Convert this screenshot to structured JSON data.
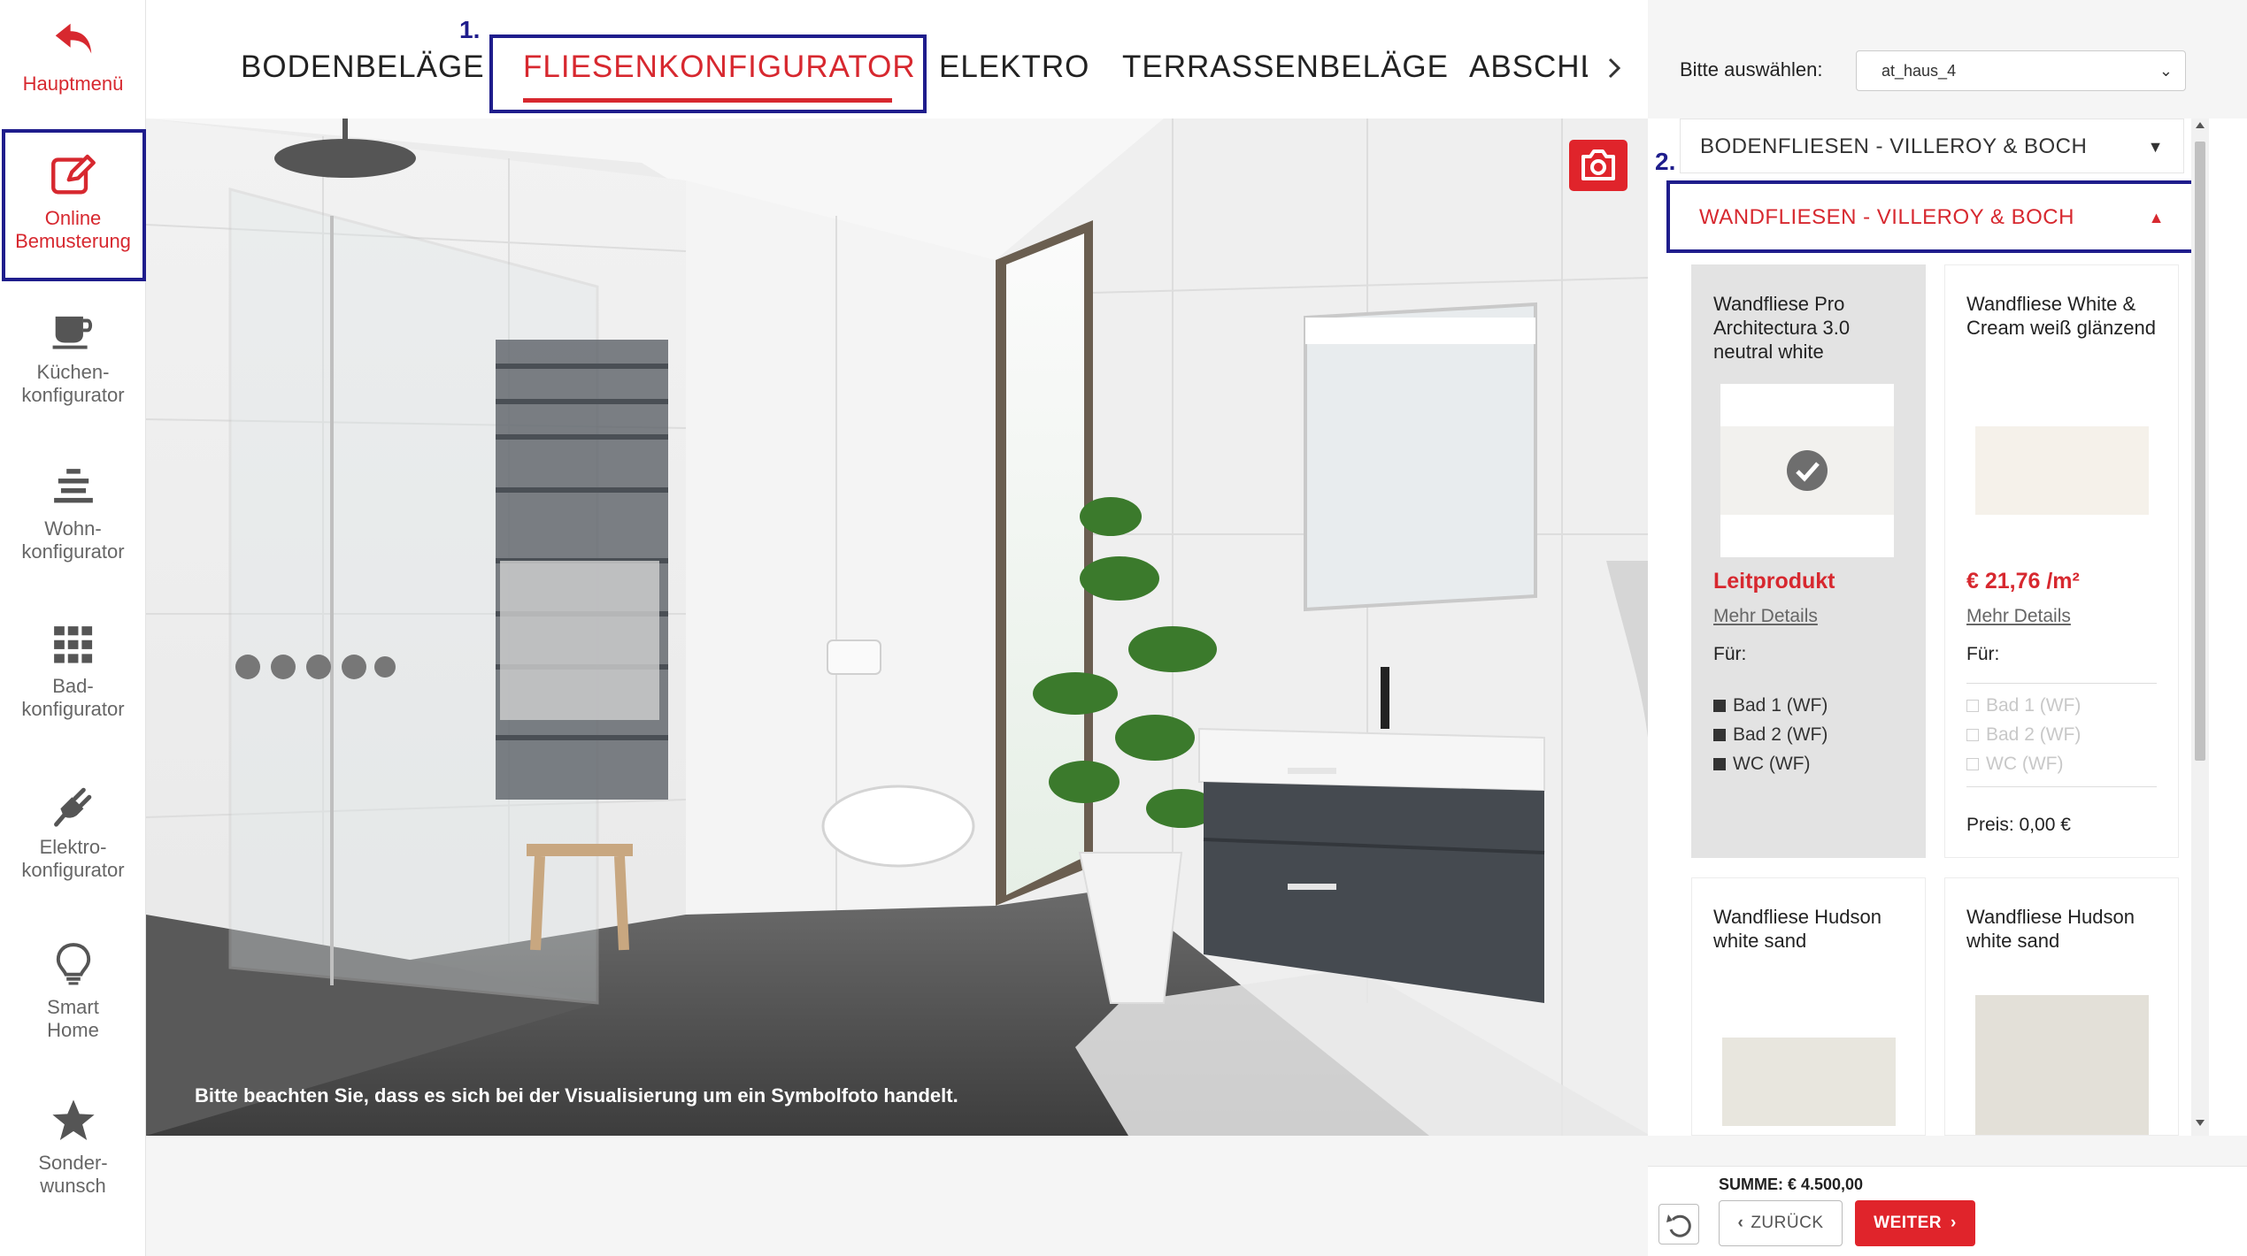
{
  "sidebar": {
    "items": [
      {
        "label": "Hauptmenü",
        "icon": "back-arrow-icon"
      },
      {
        "label_line1": "Online",
        "label_line2": "Bemusterung",
        "icon": "edit-icon"
      },
      {
        "label_line1": "Küchen-",
        "label_line2": "konfigurator",
        "icon": "cup-icon"
      },
      {
        "label_line1": "Wohn-",
        "label_line2": "konfigurator",
        "icon": "layers-icon"
      },
      {
        "label_line1": "Bad-",
        "label_line2": "konfigurator",
        "icon": "grid-icon"
      },
      {
        "label_line1": "Elektro-",
        "label_line2": "konfigurator",
        "icon": "plug-icon"
      },
      {
        "label_line1": "Smart",
        "label_line2": "Home",
        "icon": "lightbulb-icon"
      },
      {
        "label_line1": "Sonder-",
        "label_line2": "wunsch",
        "icon": "star-icon"
      }
    ]
  },
  "annotations": {
    "step1": "1.",
    "step2": "2."
  },
  "tabs": {
    "items": [
      "BODENBELÄGE",
      "FLIESENKONFIGURATOR",
      "ELEKTRO",
      "TERRASSENBELÄGE",
      "ABSCHL"
    ],
    "active": "FLIESENKONFIGURATOR"
  },
  "house_select": {
    "label": "Bitte auswählen:",
    "value": "at_haus_4"
  },
  "scene": {
    "disclaimer": "Bitte beachten Sie, dass es sich bei der Visualisierung um ein Symbolfoto handelt."
  },
  "accordion": {
    "floor": "BODENFLIESEN - VILLEROY & BOCH",
    "wall": "WANDFLIESEN - VILLEROY & BOCH"
  },
  "products": [
    {
      "title": "Wandfliese Pro Architectura 3.0 neutral white",
      "price": "Leitprodukt",
      "details": "Mehr Details",
      "for_label": "Für:",
      "rooms": [
        "Bad 1 (WF)",
        "Bad 2 (WF)",
        "WC (WF)"
      ],
      "selected": true
    },
    {
      "title": "Wandfliese White & Cream weiß glänzend",
      "price": "€ 21,76 /m²",
      "details": "Mehr Details",
      "for_label": "Für:",
      "rooms": [
        "Bad 1 (WF)",
        "Bad 2 (WF)",
        "WC (WF)"
      ],
      "preis": "Preis: 0,00 €",
      "selected": false
    },
    {
      "title": "Wandfliese Hudson white sand"
    },
    {
      "title": "Wandfliese Hudson white sand"
    }
  ],
  "footer": {
    "sum": "SUMME: € 4.500,00",
    "back": "ZURÜCK",
    "next": "WEITER"
  },
  "colors": {
    "accent": "#d7282f",
    "highlight": "#1f1d8c"
  }
}
